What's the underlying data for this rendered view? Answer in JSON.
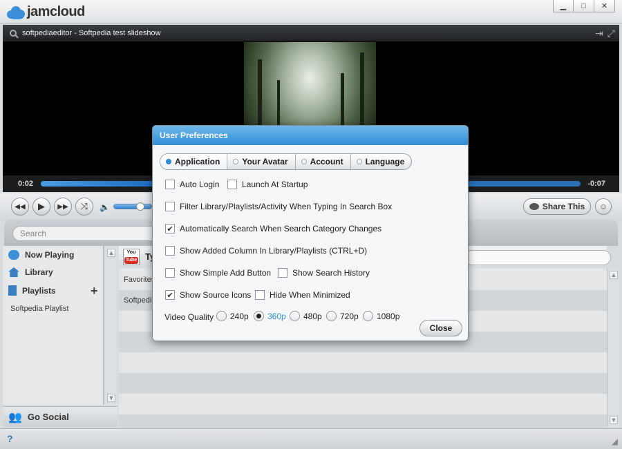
{
  "app": {
    "name": "jamcloud"
  },
  "window": {
    "minimize": "▁",
    "maximize": "□",
    "close": "✕"
  },
  "player": {
    "title": "softpediaeditor - Softpedia test slideshow",
    "elapsed": "0:02",
    "remaining": "-0:07",
    "progress": 0.2
  },
  "controls": {
    "share_label": "Share This",
    "volume": 0.7
  },
  "search": {
    "placeholder": "Search"
  },
  "sidebar": {
    "items": [
      {
        "label": "Now Playing"
      },
      {
        "label": "Library"
      },
      {
        "label": "Playlists"
      }
    ],
    "playlists": [
      "Softpedia Playlist"
    ],
    "go_social": "Go Social"
  },
  "main": {
    "header_title": "Ty",
    "yt_top": "You",
    "yt_bottom": "Tube",
    "rows": [
      "Favorites",
      "Softpedia"
    ]
  },
  "dialog": {
    "title": "User Preferences",
    "tabs": [
      {
        "label": "Application",
        "active": true
      },
      {
        "label": "Your Avatar",
        "active": false
      },
      {
        "label": "Account",
        "active": false
      },
      {
        "label": "Language",
        "active": false
      }
    ],
    "options": {
      "auto_login": {
        "label": "Auto Login",
        "checked": false
      },
      "launch_startup": {
        "label": "Launch At Startup",
        "checked": false
      },
      "filter_library": {
        "label": "Filter Library/Playlists/Activity When Typing In Search Box",
        "checked": false
      },
      "auto_search": {
        "label": "Automatically Search When Search Category Changes",
        "checked": true
      },
      "show_added": {
        "label": "Show Added Column In Library/Playlists (CTRL+D)",
        "checked": false
      },
      "simple_add": {
        "label": "Show Simple Add Button",
        "checked": false
      },
      "search_history": {
        "label": "Show Search History",
        "checked": false
      },
      "source_icons": {
        "label": "Show Source Icons",
        "checked": true
      },
      "hide_minimized": {
        "label": "Hide When Minimized",
        "checked": false
      }
    },
    "video_quality": {
      "label": "Video Quality",
      "options": [
        "240p",
        "360p",
        "480p",
        "720p",
        "1080p"
      ],
      "selected": "360p"
    },
    "close_label": "Close"
  },
  "colors": {
    "accent": "#2f8fd8",
    "title_gradient_top": "#6fb6ea"
  }
}
